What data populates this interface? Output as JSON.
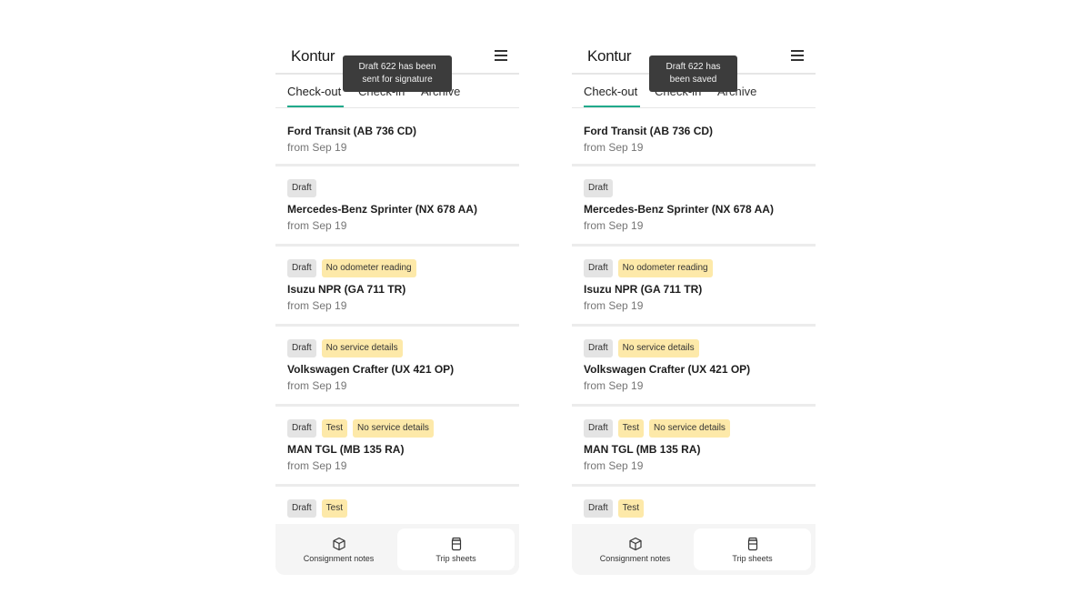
{
  "screens": [
    {
      "logo": "Kontur",
      "toast": {
        "line1": "Draft 622 has been",
        "line2": "sent for signature"
      },
      "tabs": [
        "Check-out",
        "Check-in",
        "Archive"
      ],
      "items": [
        {
          "badges": [],
          "title": "Ford Transit (AB 736 CD)",
          "date": "from Sep 19"
        },
        {
          "badges": [
            {
              "label": "Draft",
              "kind": "draft"
            }
          ],
          "title": "Mercedes-Benz Sprinter (NX 678 AA)",
          "date": "from Sep 19"
        },
        {
          "badges": [
            {
              "label": "Draft",
              "kind": "draft"
            },
            {
              "label": "No odometer reading",
              "kind": "warn"
            }
          ],
          "title": "Isuzu NPR (GA 711 TR)",
          "date": "from Sep 19"
        },
        {
          "badges": [
            {
              "label": "Draft",
              "kind": "draft"
            },
            {
              "label": "No service details",
              "kind": "warn"
            }
          ],
          "title": "Volkswagen Crafter (UX 421 OP)",
          "date": "from Sep 19"
        },
        {
          "badges": [
            {
              "label": "Draft",
              "kind": "draft"
            },
            {
              "label": "Test",
              "kind": "warn"
            },
            {
              "label": "No service details",
              "kind": "warn"
            }
          ],
          "title": "MAN TGL (MB 135 RA)",
          "date": "from Sep 19"
        },
        {
          "badges": [
            {
              "label": "Draft",
              "kind": "draft"
            },
            {
              "label": "Test",
              "kind": "warn"
            }
          ],
          "title": "",
          "date": ""
        }
      ],
      "nav": [
        {
          "label": "Consignment notes",
          "icon": "package-icon",
          "active": false
        },
        {
          "label": "Trip sheets",
          "icon": "jar-icon",
          "active": true
        }
      ]
    },
    {
      "logo": "Kontur",
      "toast": {
        "line1": "Draft 622 has",
        "line2": "been saved"
      },
      "tabs": [
        "Check-out",
        "Check-in",
        "Archive"
      ],
      "items": [
        {
          "badges": [],
          "title": "Ford Transit (AB 736 CD)",
          "date": "from Sep 19"
        },
        {
          "badges": [
            {
              "label": "Draft",
              "kind": "draft"
            }
          ],
          "title": "Mercedes-Benz Sprinter (NX 678 AA)",
          "date": "from Sep 19"
        },
        {
          "badges": [
            {
              "label": "Draft",
              "kind": "draft"
            },
            {
              "label": "No odometer reading",
              "kind": "warn"
            }
          ],
          "title": "Isuzu NPR (GA 711 TR)",
          "date": "from Sep 19"
        },
        {
          "badges": [
            {
              "label": "Draft",
              "kind": "draft"
            },
            {
              "label": "No service details",
              "kind": "warn"
            }
          ],
          "title": "Volkswagen Crafter (UX 421 OP)",
          "date": "from Sep 19"
        },
        {
          "badges": [
            {
              "label": "Draft",
              "kind": "draft"
            },
            {
              "label": "Test",
              "kind": "warn"
            },
            {
              "label": "No service details",
              "kind": "warn"
            }
          ],
          "title": "MAN TGL (MB 135 RA)",
          "date": "from Sep 19"
        },
        {
          "badges": [
            {
              "label": "Draft",
              "kind": "draft"
            },
            {
              "label": "Test",
              "kind": "warn"
            }
          ],
          "title": "",
          "date": ""
        }
      ],
      "nav": [
        {
          "label": "Consignment notes",
          "icon": "package-icon",
          "active": false
        },
        {
          "label": "Trip sheets",
          "icon": "jar-icon",
          "active": true
        }
      ]
    }
  ]
}
